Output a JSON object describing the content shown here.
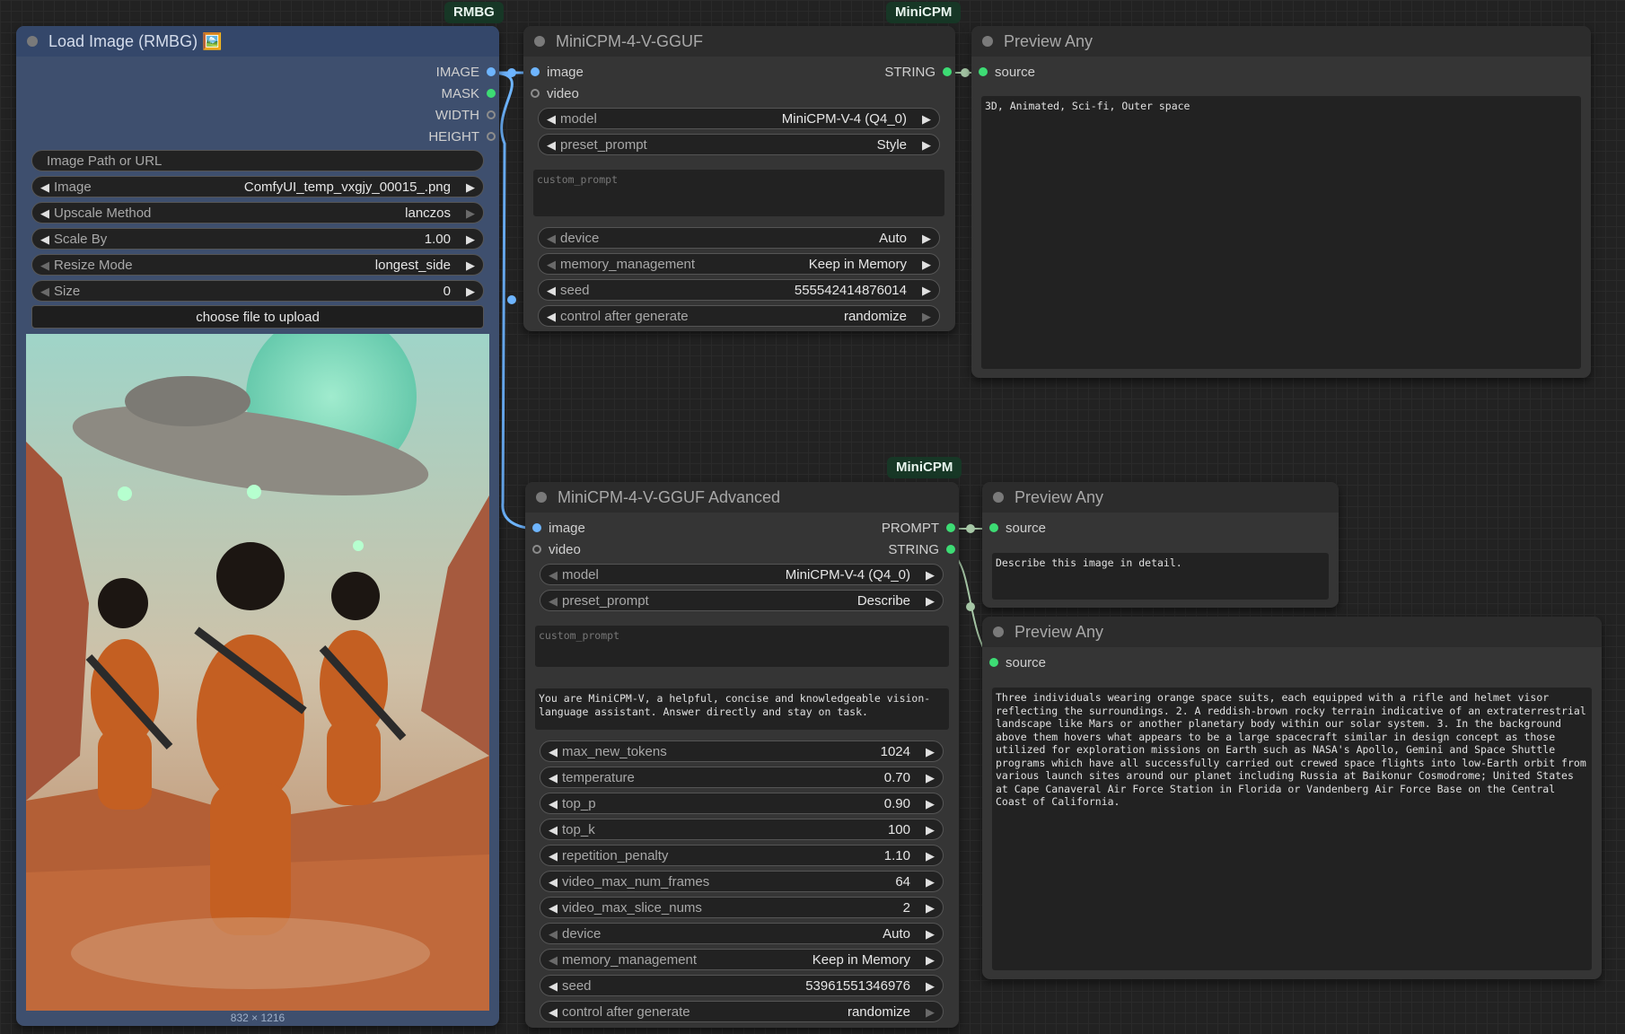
{
  "load_image": {
    "badge": "RMBG",
    "title": "Load Image (RMBG) 🖼️",
    "outputs": [
      "IMAGE",
      "MASK",
      "WIDTH",
      "HEIGHT"
    ],
    "path_placeholder": "Image Path or URL",
    "image_label": "Image",
    "image_value": "ComfyUI_temp_vxgjy_00015_.png",
    "upscale_label": "Upscale Method",
    "upscale_value": "lanczos",
    "scale_label": "Scale By",
    "scale_value": "1.00",
    "resize_label": "Resize Mode",
    "resize_value": "longest_side",
    "size_label": "Size",
    "size_value": "0",
    "upload_button": "choose file to upload",
    "image_caption": "832 × 1216"
  },
  "minicpm": {
    "badge": "MiniCPM",
    "title": "MiniCPM-4-V-GGUF",
    "in_image": "image",
    "in_video": "video",
    "out_string": "STRING",
    "model_label": "model",
    "model_value": "MiniCPM-V-4 (Q4_0)",
    "preset_label": "preset_prompt",
    "preset_value": "Style",
    "custom_placeholder": "custom_prompt",
    "device_label": "device",
    "device_value": "Auto",
    "memory_label": "memory_management",
    "memory_value": "Keep in Memory",
    "seed_label": "seed",
    "seed_value": "555542414876014",
    "control_label": "control after generate",
    "control_value": "randomize"
  },
  "preview1": {
    "title": "Preview Any",
    "in_source": "source",
    "text": "3D, Animated, Sci-fi, Outer space"
  },
  "minicpm_adv": {
    "badge": "MiniCPM",
    "title": "MiniCPM-4-V-GGUF Advanced",
    "in_image": "image",
    "in_video": "video",
    "out_prompt": "PROMPT",
    "out_string": "STRING",
    "model_label": "model",
    "model_value": "MiniCPM-V-4 (Q4_0)",
    "preset_label": "preset_prompt",
    "preset_value": "Describe",
    "custom_placeholder": "custom_prompt",
    "system_prompt": "You are MiniCPM-V, a helpful, concise and knowledgeable vision-language assistant. Answer directly and stay on task.",
    "max_tokens_label": "max_new_tokens",
    "max_tokens_value": "1024",
    "temperature_label": "temperature",
    "temperature_value": "0.70",
    "top_p_label": "top_p",
    "top_p_value": "0.90",
    "top_k_label": "top_k",
    "top_k_value": "100",
    "rep_label": "repetition_penalty",
    "rep_value": "1.10",
    "frames_label": "video_max_num_frames",
    "frames_value": "64",
    "slices_label": "video_max_slice_nums",
    "slices_value": "2",
    "device_label": "device",
    "device_value": "Auto",
    "memory_label": "memory_management",
    "memory_value": "Keep in Memory",
    "seed_label": "seed",
    "seed_value": "53961551346976",
    "control_label": "control after generate",
    "control_value": "randomize"
  },
  "preview2": {
    "title": "Preview Any",
    "in_source": "source",
    "text": "Describe this image in detail."
  },
  "preview3": {
    "title": "Preview Any",
    "in_source": "source",
    "text": "Three individuals wearing orange space suits, each equipped with a rifle and helmet visor reflecting the surroundings. 2. A reddish-brown rocky terrain indicative of an extraterrestrial landscape like Mars or another planetary body within our solar system. 3. In the background above them hovers what appears to be a large spacecraft similar in design concept as those utilized for exploration missions on Earth such as NASA's Apollo, Gemini and Space Shuttle programs which have all successfully carried out crewed space flights into low-Earth orbit from various launch sites around our planet including Russia at Baikonur Cosmodrome; United States at Cape Canaveral Air Force Station in Florida or Vandenberg Air Force Base on the Central Coast of California."
  },
  "colors": {
    "image_link": "#6eb5ff",
    "string_link": "#a6c7a6",
    "badge_bg": "#173726"
  }
}
